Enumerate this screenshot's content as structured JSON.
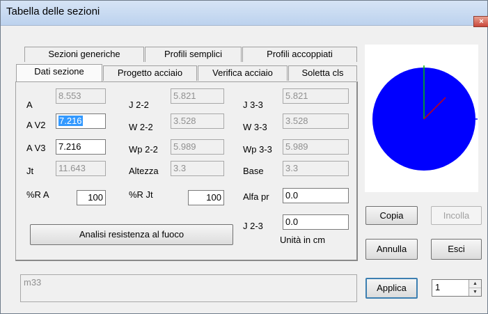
{
  "window": {
    "title": "Tabella delle sezioni",
    "close_glyph": "×"
  },
  "tabs": {
    "row1": [
      "Sezioni generiche",
      "Profili semplici",
      "Profili accoppiati"
    ],
    "row2": [
      "Dati sezione",
      "Progetto acciaio",
      "Verifica acciaio",
      "Soletta cls"
    ],
    "active": "Dati sezione"
  },
  "fields": {
    "A": {
      "label": "A",
      "value": "8.553"
    },
    "AV2": {
      "label": "A V2",
      "value": "7.216"
    },
    "AV3": {
      "label": "A V3",
      "value": "7.216"
    },
    "Jt": {
      "label": "Jt",
      "value": "11.643"
    },
    "RA": {
      "label": "%R A",
      "value": "100"
    },
    "J22": {
      "label": "J 2-2",
      "value": "5.821"
    },
    "W22": {
      "label": "W 2-2",
      "value": "3.528"
    },
    "Wp22": {
      "label": "Wp 2-2",
      "value": "5.989"
    },
    "Altezza": {
      "label": "Altezza",
      "value": "3.3"
    },
    "RJt": {
      "label": "%R Jt",
      "value": "100"
    },
    "J33": {
      "label": "J 3-3",
      "value": "5.821"
    },
    "W33": {
      "label": "W 3-3",
      "value": "3.528"
    },
    "Wp33": {
      "label": "Wp 3-3",
      "value": "5.989"
    },
    "Base": {
      "label": "Base",
      "value": "3.3"
    },
    "Alfa": {
      "label": "Alfa pr",
      "value": "0.0"
    },
    "J23": {
      "label": "J 2-3",
      "value": "0.0"
    }
  },
  "units_label": "Unità in cm",
  "buttons": {
    "fire": "Analisi resistenza al fuoco",
    "copia": "Copia",
    "incolla": "Incolla",
    "annulla": "Annulla",
    "esci": "Esci",
    "applica": "Applica"
  },
  "notes_text": "m33",
  "spinner_value": "1",
  "colors": {
    "section_fill": "#0000ff",
    "axis2": "#00c000",
    "axis3": "#0000ff",
    "axis_diag": "#d00000",
    "selection": "#3399ff"
  },
  "icons": {
    "spin_up": "▲",
    "spin_down": "▼"
  }
}
